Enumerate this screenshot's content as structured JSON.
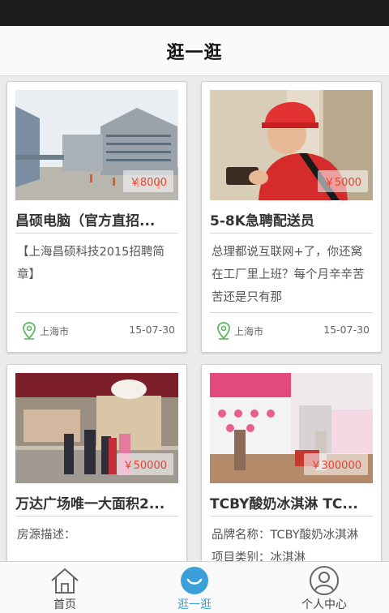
{
  "header": {
    "title": "逛一逛"
  },
  "cards": [
    {
      "title": "昌硕电脑（官方直招...",
      "price": "￥8000",
      "desc": "【上海昌硕科技2015招聘简章】",
      "location": "上海市",
      "date": "15-07-30"
    },
    {
      "title": "5-8K急聘配送员",
      "price": "￥5000",
      "desc": "总理都说互联网+了，你还窝在工厂里上班？每个月辛辛苦苦还是只有那",
      "location": "上海市",
      "date": "15-07-30"
    },
    {
      "title": "万达广场唯一大面积2...",
      "price": "￥50000",
      "desc": "房源描述：",
      "location": "",
      "date": ""
    },
    {
      "title": "TCBY酸奶冰淇淋 TC...",
      "price": "￥300000",
      "desc": "品牌名称：TCBY酸奶冰淇淋 项目类别：冰淇淋",
      "location": "",
      "date": ""
    }
  ],
  "tabs": [
    {
      "label": "首页",
      "icon": "home-icon"
    },
    {
      "label": "逛一逛",
      "icon": "browse-icon"
    },
    {
      "label": "个人中心",
      "icon": "user-icon"
    }
  ],
  "colors": {
    "price": "#e8432f",
    "accent": "#3aa0d9",
    "location_pin": "#5cb85c"
  }
}
